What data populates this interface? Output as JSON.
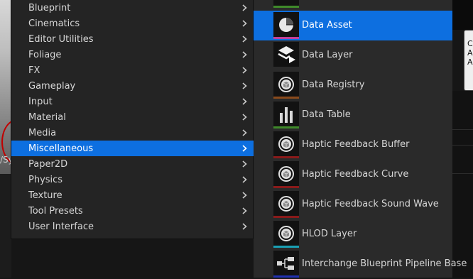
{
  "left_menu": {
    "items": [
      {
        "label": "Blueprint"
      },
      {
        "label": "Cinematics"
      },
      {
        "label": "Editor Utilities"
      },
      {
        "label": "Foliage"
      },
      {
        "label": "FX"
      },
      {
        "label": "Gameplay"
      },
      {
        "label": "Input"
      },
      {
        "label": "Material"
      },
      {
        "label": "Media"
      },
      {
        "label": "Miscellaneous",
        "selected": true
      },
      {
        "label": "Paper2D"
      },
      {
        "label": "Physics"
      },
      {
        "label": "Texture"
      },
      {
        "label": "Tool Presets"
      },
      {
        "label": "User Interface"
      }
    ]
  },
  "right_menu": {
    "items": [
      {
        "label": "Data Asset",
        "icon": "pie-chart-icon",
        "strip_color": "#c0409a",
        "selected": true
      },
      {
        "label": "Data Layer",
        "icon": "layers-icon",
        "strip_color": "#2a2a2a"
      },
      {
        "label": "Data Registry",
        "icon": "object-icon",
        "strip_color": "#8a4a1c"
      },
      {
        "label": "Data Table",
        "icon": "table-bars-icon",
        "strip_color": "#3f8a2a"
      },
      {
        "label": "Haptic Feedback Buffer",
        "icon": "object-icon",
        "strip_color": "#8a1a1a"
      },
      {
        "label": "Haptic Feedback Curve",
        "icon": "object-icon",
        "strip_color": "#8a1a1a"
      },
      {
        "label": "Haptic Feedback Sound Wave",
        "icon": "object-icon",
        "strip_color": "#8a1a1a"
      },
      {
        "label": "HLOD Layer",
        "icon": "object-icon",
        "strip_color": "#1aa0b4"
      },
      {
        "label": "Interchange Blueprint Pipeline Base",
        "icon": "node-graph-icon",
        "strip_color": "#2030b0"
      }
    ]
  },
  "colors": {
    "selection": "#0d6fe0",
    "menu_bg": "#242424",
    "submenu_bg": "#2a2a2a"
  }
}
